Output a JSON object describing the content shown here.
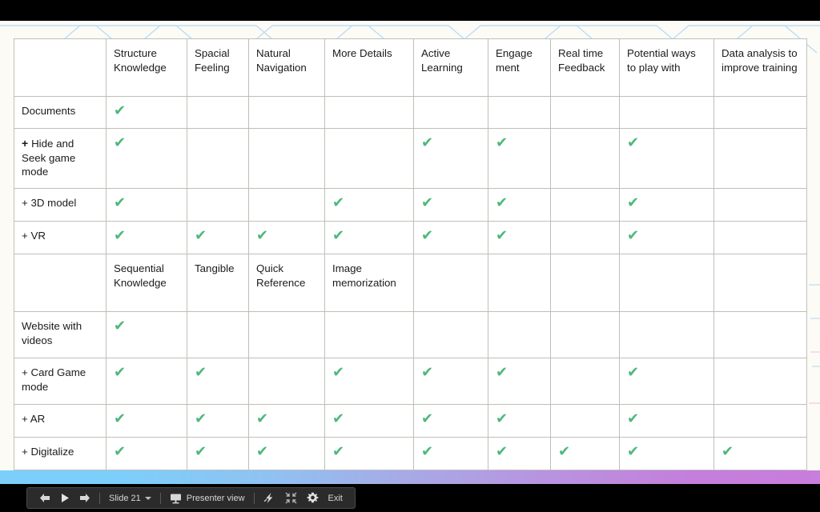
{
  "slide": {
    "background_color": "#FDFBF6",
    "accent_yellow": "#FDEFCB",
    "check_color": "#4EB87B",
    "deco_line_color": "#BDDDF4"
  },
  "gradient_bar": {
    "start_color": "#7CCFFA",
    "end_color": "#C97DDC"
  },
  "table": {
    "section_one": {
      "headers": [
        "",
        "Structure Knowledge",
        "Spacial Feeling",
        "Natural Navigation",
        "More Details",
        "Active Learning",
        "Engage ment",
        "Real time Feedback",
        "Potential ways to play with",
        "Data analysis to improve training"
      ],
      "header_lines": [
        [
          ""
        ],
        [
          "Structure",
          "Knowledge"
        ],
        [
          "Spacial",
          "Feeling"
        ],
        [
          "Natural",
          "Navigation"
        ],
        [
          "More Details"
        ],
        [
          "Active",
          "Learning"
        ],
        [
          "Engage",
          "ment"
        ],
        [
          "Real time",
          "Feedback"
        ],
        [
          "Potential ways",
          "to play with"
        ],
        [
          "Data analysis to",
          "improve training"
        ]
      ],
      "rows": [
        {
          "label_lines": [
            "Documents"
          ],
          "prefix": "",
          "checks": [
            true,
            false,
            false,
            false,
            false,
            false,
            false,
            false,
            false
          ]
        },
        {
          "label_lines": [
            "Hide and",
            "Seek game",
            "mode"
          ],
          "prefix": "+",
          "prefix_bold": true,
          "checks": [
            true,
            false,
            false,
            false,
            true,
            true,
            false,
            true,
            false
          ]
        },
        {
          "label_lines": [
            "3D model"
          ],
          "prefix": "+",
          "checks": [
            true,
            false,
            false,
            true,
            true,
            true,
            false,
            true,
            false
          ]
        },
        {
          "label_lines": [
            "VR"
          ],
          "prefix": "+",
          "checks": [
            true,
            true,
            true,
            true,
            true,
            true,
            false,
            true,
            false
          ]
        }
      ]
    },
    "section_two": {
      "header_lines": [
        [
          ""
        ],
        [
          "Sequential",
          "Knowledge"
        ],
        [
          "Tangible"
        ],
        [
          "Quick",
          "Reference"
        ],
        [
          "Image",
          "memorization"
        ],
        [
          ""
        ],
        [
          ""
        ],
        [
          ""
        ],
        [
          ""
        ],
        [
          ""
        ]
      ],
      "rows": [
        {
          "label_lines": [
            "Website with",
            "videos"
          ],
          "prefix": "",
          "checks": [
            true,
            false,
            false,
            false,
            false,
            false,
            false,
            false,
            false
          ]
        },
        {
          "label_lines": [
            "Card Game",
            "mode"
          ],
          "prefix": "+",
          "checks": [
            true,
            true,
            false,
            true,
            true,
            true,
            false,
            true,
            false
          ]
        },
        {
          "label_lines": [
            "AR"
          ],
          "prefix": "+",
          "checks": [
            true,
            true,
            true,
            true,
            true,
            true,
            false,
            true,
            false
          ]
        },
        {
          "label_lines": [
            "Digitalize"
          ],
          "prefix": "+",
          "checks": [
            true,
            true,
            true,
            true,
            true,
            true,
            true,
            true,
            true
          ]
        }
      ]
    },
    "check_glyph": "✔"
  },
  "toolbar": {
    "prev_icon": "arrow-left-icon",
    "play_icon": "play-icon",
    "next_icon": "arrow-right-icon",
    "slide_label": "Slide 21",
    "presenter_icon": "presenter-screen-icon",
    "presenter_label": "Presenter view",
    "laser_icon": "laser-pointer-icon",
    "collapse_icon": "exit-fullscreen-icon",
    "settings_icon": "gear-icon",
    "exit_label": "Exit"
  }
}
